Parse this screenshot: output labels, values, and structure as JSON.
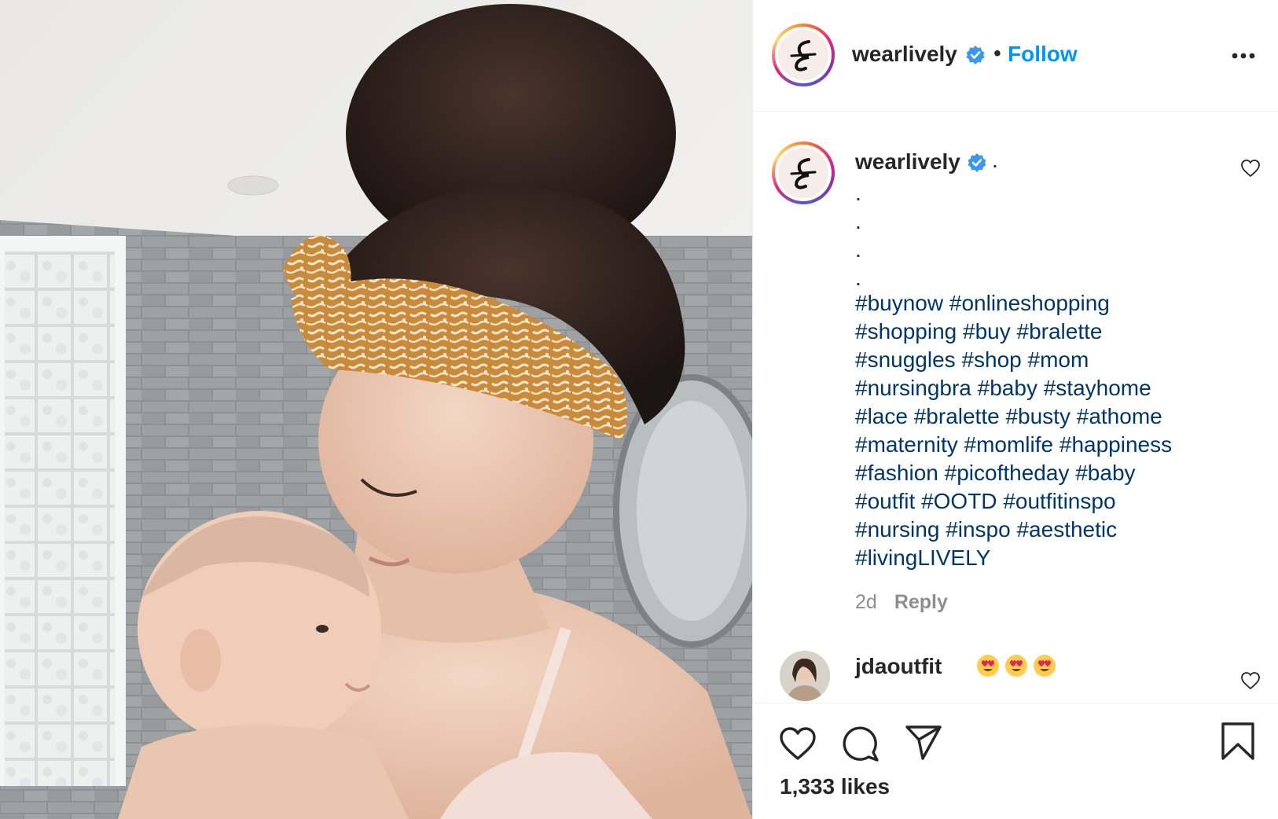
{
  "post": {
    "author": "wearlively",
    "verified": true,
    "separator": "•",
    "follow_label": "Follow",
    "more_icon": "more-options-icon",
    "photo_alt": "mother-and-baby-photo"
  },
  "caption": {
    "author": "wearlively",
    "first_line": ".",
    "dots": ".\n.\n.\n.",
    "hashtag_lines": [
      [
        "#buynow",
        "#onlineshopping"
      ],
      [
        "#shopping",
        "#buy",
        "#bralette"
      ],
      [
        "#snuggles",
        "#shop",
        "#mom"
      ],
      [
        "#nursingbra",
        "#baby",
        "#stayhome"
      ],
      [
        "#lace",
        "#bralette",
        "#busty",
        "#athome"
      ],
      [
        "#maternity",
        "#momlife",
        "#happiness"
      ],
      [
        "#fashion",
        "#picoftheday",
        "#baby"
      ],
      [
        "#outfit",
        "#OOTD",
        "#outfitinspo"
      ],
      [
        "#nursing",
        "#inspo",
        "#aesthetic"
      ],
      [
        "#livingLIVELY"
      ]
    ],
    "age": "2d",
    "reply_label": "Reply"
  },
  "comments": [
    {
      "author": "jdaoutfit",
      "emojis": [
        "heart-eyes-emoji",
        "heart-eyes-emoji",
        "heart-eyes-emoji"
      ]
    }
  ],
  "actions": {
    "like_icon": "heart-icon",
    "comment_icon": "comment-icon",
    "share_icon": "share-icon",
    "save_icon": "bookmark-icon"
  },
  "likes_text": "1,333 likes",
  "colors": {
    "link_blue": "#0095f6",
    "hashtag": "#00376b",
    "muted": "#8e8e8e",
    "text": "#262626"
  }
}
